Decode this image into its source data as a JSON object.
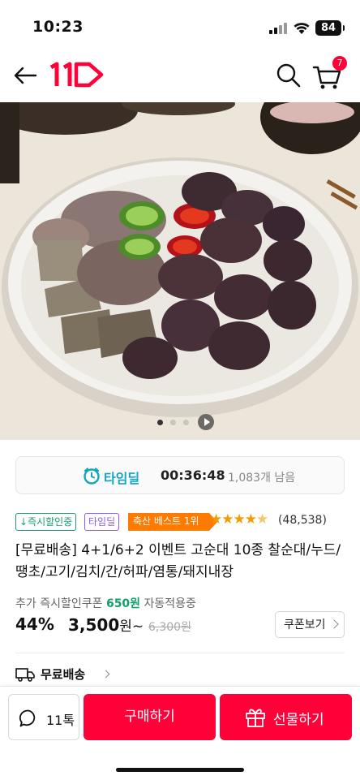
{
  "status_bar": {
    "time": "10:23",
    "battery": "84"
  },
  "header": {
    "cart_count": "7"
  },
  "carousel": {
    "dots": 3,
    "active_index": 0
  },
  "time_deal": {
    "label": "타임딜",
    "timer": "00:36:48",
    "remaining": "1,083개 남음"
  },
  "badges": {
    "discount": "↓즉시할인중",
    "timedeal": "타임딜",
    "best": "축산 베스트 1위"
  },
  "rating": {
    "stars": 4.5,
    "review_count": "(48,538)"
  },
  "product": {
    "title": "[무료배송] 4+1/6+2 이벤트 고순대 10종 찰순대/누드/땡초/고기/김치/간/허파/염통/돼지내장"
  },
  "price": {
    "coupon_prefix": "추가 즉시할인쿠폰",
    "coupon_amount": "650원",
    "coupon_suffix": "자동적용중",
    "discount_rate": "44%",
    "sale_price": "3,500",
    "sale_unit": "원~",
    "original_price": "6,300원",
    "coupon_button": "쿠폰보기"
  },
  "shipping": {
    "label": "무료배송"
  },
  "bottom_bar": {
    "talk_label": "11톡",
    "buy_label": "구매하기",
    "gift_label": "선물하기"
  },
  "colors": {
    "brand": "#ff0038",
    "timedeal": "#12a6c0",
    "coupon": "#12a06a",
    "best": "#ff7a00"
  }
}
